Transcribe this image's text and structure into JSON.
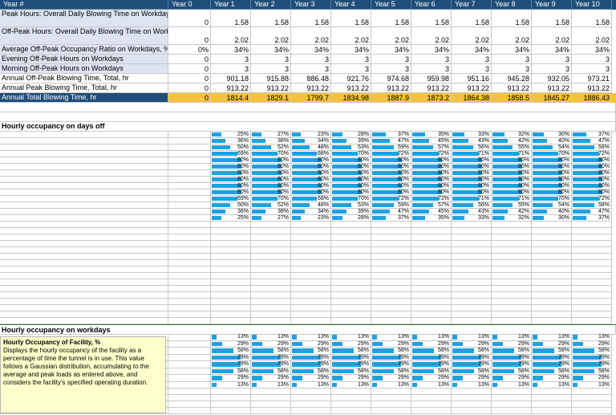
{
  "header": {
    "label": "Year #",
    "years": [
      "Year 0",
      "Year 1",
      "Year 2",
      "Year 3",
      "Year 4",
      "Year 5",
      "Year 6",
      "Year 7",
      "Year 8",
      "Year 9",
      "Year 10"
    ]
  },
  "rows": [
    {
      "label": "Peak Hours: Overall Daily Blowing Time on Workdays, hr",
      "values": [
        "0",
        "1.58",
        "1.58",
        "1.58",
        "1.58",
        "1.58",
        "1.58",
        "1.58",
        "1.58",
        "1.58",
        "1.58"
      ],
      "input": true
    },
    {
      "label": "Off-Peak Hours: Overall Daily Blowing Time on Workdays, hr",
      "values": [
        "0",
        "2.02",
        "2.02",
        "2.02",
        "2.02",
        "2.02",
        "2.02",
        "2.02",
        "2.02",
        "2.02",
        "2.02"
      ],
      "input": true
    },
    {
      "label": "Average Off-Peak Occupancy Ratio on Workdays, %",
      "values": [
        "0%",
        "34%",
        "34%",
        "34%",
        "34%",
        "34%",
        "34%",
        "34%",
        "34%",
        "34%",
        "34%"
      ],
      "input": true
    },
    {
      "label": "Evening Off-Peak Hours on Workdays",
      "values": [
        "0",
        "3",
        "3",
        "3",
        "3",
        "3",
        "3",
        "3",
        "3",
        "3",
        "3"
      ],
      "input": true
    },
    {
      "label": "Morning Off-Peak Hours on Workdays",
      "values": [
        "0",
        "3",
        "3",
        "3",
        "3",
        "3",
        "3",
        "3",
        "3",
        "3",
        "3"
      ],
      "input": true
    },
    {
      "label": "Annual Off-Peak Blowing Time, Total, hr",
      "values": [
        "0",
        "901.18",
        "915.88",
        "886.48",
        "921.76",
        "974.68",
        "959.98",
        "951.16",
        "945.28",
        "932.05",
        "973.21"
      ],
      "input": false
    },
    {
      "label": "Annual Peak Blowing Time, Total, hr",
      "values": [
        "0",
        "913.22",
        "913.22",
        "913.22",
        "913.22",
        "913.22",
        "913.22",
        "913.22",
        "913.22",
        "913.22",
        "913.22"
      ],
      "input": false
    }
  ],
  "total": {
    "label": "Annual Total Blowing Time, hr",
    "values": [
      "0",
      "1814.4",
      "1829.1",
      "1799.7",
      "1834.98",
      "1887.9",
      "1873.2",
      "1864.38",
      "1858.5",
      "1845.27",
      "1886.43"
    ]
  },
  "section1": {
    "title": "Hourly occupancy on days off"
  },
  "daysoff": [
    [
      "25%",
      "27%",
      "23%",
      "28%",
      "37%",
      "35%",
      "33%",
      "32%",
      "30%",
      "37%"
    ],
    [
      "36%",
      "38%",
      "34%",
      "39%",
      "47%",
      "45%",
      "43%",
      "42%",
      "40%",
      "47%"
    ],
    [
      "50%",
      "52%",
      "48%",
      "53%",
      "59%",
      "57%",
      "56%",
      "55%",
      "54%",
      "58%"
    ],
    [
      "69%",
      "70%",
      "68%",
      "70%",
      "72%",
      "72%",
      "71%",
      "71%",
      "70%",
      "72%"
    ],
    [
      "80%",
      "80%",
      "80%",
      "80%",
      "80%",
      "80%",
      "80%",
      "80%",
      "80%",
      "80%"
    ],
    [
      "80%",
      "80%",
      "80%",
      "80%",
      "80%",
      "80%",
      "80%",
      "80%",
      "80%",
      "80%"
    ],
    [
      "80%",
      "80%",
      "80%",
      "80%",
      "80%",
      "80%",
      "80%",
      "80%",
      "80%",
      "80%"
    ],
    [
      "80%",
      "80%",
      "80%",
      "80%",
      "80%",
      "80%",
      "80%",
      "80%",
      "80%",
      "80%"
    ],
    [
      "80%",
      "80%",
      "80%",
      "80%",
      "80%",
      "80%",
      "80%",
      "80%",
      "80%",
      "80%"
    ],
    [
      "80%",
      "80%",
      "80%",
      "80%",
      "80%",
      "80%",
      "80%",
      "80%",
      "80%",
      "80%"
    ],
    [
      "69%",
      "70%",
      "68%",
      "70%",
      "72%",
      "72%",
      "71%",
      "71%",
      "70%",
      "72%"
    ],
    [
      "50%",
      "52%",
      "48%",
      "53%",
      "59%",
      "57%",
      "56%",
      "55%",
      "54%",
      "58%"
    ],
    [
      "36%",
      "38%",
      "34%",
      "39%",
      "47%",
      "45%",
      "43%",
      "42%",
      "40%",
      "47%"
    ],
    [
      "25%",
      "27%",
      "23%",
      "28%",
      "37%",
      "35%",
      "33%",
      "32%",
      "30%",
      "37%"
    ]
  ],
  "section2": {
    "title": "Hourly occupancy on workdays"
  },
  "workdays": [
    [
      "13%",
      "13%",
      "13%",
      "13%",
      "13%",
      "13%",
      "13%",
      "13%",
      "13%",
      "13%"
    ],
    [
      "29%",
      "29%",
      "29%",
      "29%",
      "29%",
      "29%",
      "29%",
      "29%",
      "29%",
      "29%"
    ],
    [
      "58%",
      "58%",
      "58%",
      "58%",
      "58%",
      "58%",
      "58%",
      "58%",
      "58%",
      "58%"
    ],
    [
      "79%",
      "79%",
      "79%",
      "79%",
      "79%",
      "79%",
      "79%",
      "79%",
      "79%",
      "79%"
    ],
    [
      "79%",
      "79%",
      "79%",
      "79%",
      "79%",
      "79%",
      "79%",
      "79%",
      "79%",
      "79%"
    ],
    [
      "58%",
      "58%",
      "58%",
      "58%",
      "58%",
      "58%",
      "58%",
      "58%",
      "58%",
      "58%"
    ],
    [
      "29%",
      "29%",
      "29%",
      "29%",
      "29%",
      "29%",
      "29%",
      "29%",
      "29%",
      "29%"
    ],
    [
      "13%",
      "13%",
      "13%",
      "13%",
      "13%",
      "13%",
      "13%",
      "13%",
      "13%",
      "13%"
    ]
  ],
  "note": {
    "title": "Hourly Occupancy of Facility, %",
    "body": "Displays the hourly occupancy of the facility as a percentage of time the tunnel is in use. This value follows a Gaussian distribution, accumulating to the average and peak loads as entered above, and considers the facility's specified operating duration."
  },
  "colors": {
    "header": "#1f4e79",
    "input": "#dde3f1",
    "total": "#f5c140",
    "bar": "#1fa1e0",
    "note": "#ffffcc"
  }
}
